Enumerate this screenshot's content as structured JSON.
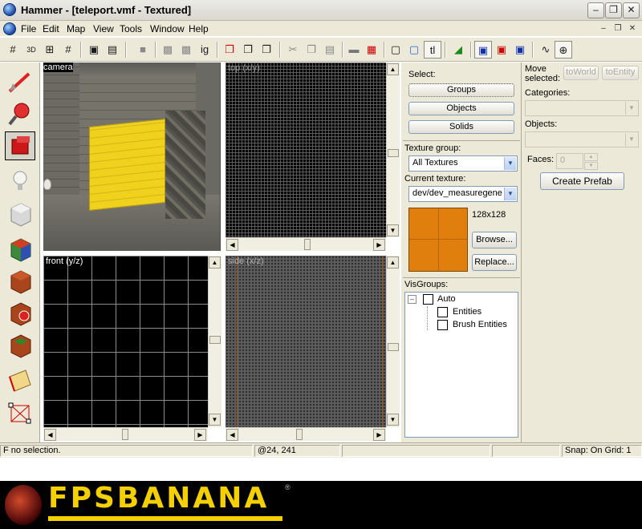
{
  "window": {
    "title": "Hammer - [teleport.vmf - Textured]"
  },
  "menu": [
    "File",
    "Edit",
    "Map",
    "View",
    "Tools",
    "Window",
    "Help"
  ],
  "toolbar": {
    "tl_label": "tl",
    "ig_label": "ig"
  },
  "viewports": {
    "camera": "camera",
    "top": "top (x/y)",
    "front": "front (y/z)",
    "side": "side (x/z)"
  },
  "select": {
    "label": "Select:",
    "groups": "Groups",
    "objects": "Objects",
    "solids": "Solids"
  },
  "texture": {
    "group_label": "Texture group:",
    "group_value": "All Textures",
    "current_label": "Current texture:",
    "current_value": "dev/dev_measuregene",
    "size": "128x128",
    "browse": "Browse...",
    "replace": "Replace...",
    "swatch_color": "#e07f0d"
  },
  "visgroups": {
    "label": "VisGroups:",
    "root": "Auto",
    "children": [
      "Entities",
      "Brush Entities"
    ]
  },
  "move": {
    "label": "Move selected:",
    "to_world": "toWorld",
    "to_entity": "toEntity"
  },
  "prefab": {
    "categories_label": "Categories:",
    "objects_label": "Objects:",
    "faces_label": "Faces:",
    "faces_value": "0",
    "create": "Create Prefab"
  },
  "status": {
    "prefix": "F",
    "selection": "no selection.",
    "coords": "@24, 241",
    "snap": "Snap: On Grid: 1"
  },
  "banner": {
    "brand": "FPSBANANA",
    "tm": "®"
  }
}
